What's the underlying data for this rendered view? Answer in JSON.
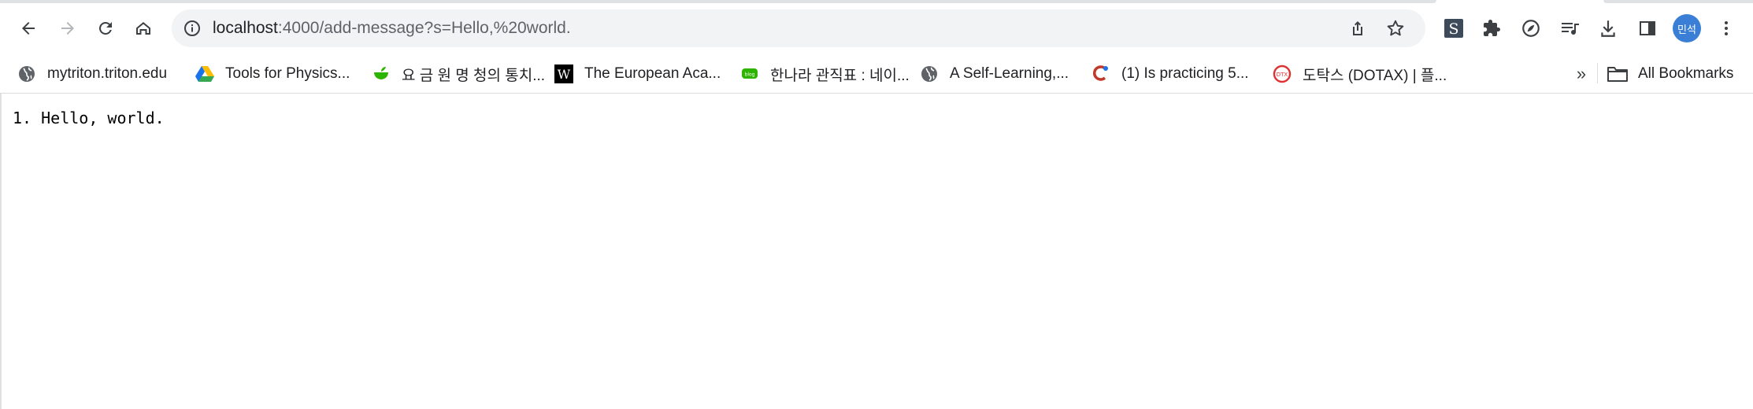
{
  "browser": {
    "url_host": "localhost",
    "url_path": ":4000/add-message?s=Hello,%20world.",
    "profile_initials": "민석"
  },
  "icons": {
    "back": "arrow-left-icon",
    "forward": "arrow-right-icon",
    "reload": "reload-icon",
    "home": "home-icon",
    "site_info": "info-icon",
    "share": "share-icon",
    "bookmark_star": "star-icon",
    "extension_s": "s-extension-icon",
    "extensions": "puzzle-icon",
    "extension_grammar": "leaf-icon",
    "reading_list": "reading-list-icon",
    "downloads": "download-icon",
    "side_panel": "side-panel-icon",
    "menu": "kebab-menu-icon"
  },
  "bookmarks": [
    {
      "label": "mytriton.triton.edu",
      "icon": "globe-icon"
    },
    {
      "label": "Tools for Physics...",
      "icon": "google-drive-icon"
    },
    {
      "label": "요 금 원 명 청의 통치...",
      "icon": "green-cup-icon"
    },
    {
      "label": "The European Aca...",
      "icon": "w-icon"
    },
    {
      "label": "한나라 관직표 : 네이...",
      "icon": "naver-blog-icon"
    },
    {
      "label": "A Self-Learning,...",
      "icon": "globe-icon"
    },
    {
      "label": "(1) Is practicing 5...",
      "icon": "quora-icon"
    },
    {
      "label": "도탁스 (DOTAX) | 플...",
      "icon": "dotax-icon"
    }
  ],
  "bookmarks_overflow": "»",
  "all_bookmarks_label": "All Bookmarks",
  "colors": {
    "accent": "#3a7fd5",
    "omnibox_bg": "#f1f3f4",
    "icon": "#5f6368"
  },
  "page": {
    "messages": [
      "1. Hello, world."
    ]
  }
}
